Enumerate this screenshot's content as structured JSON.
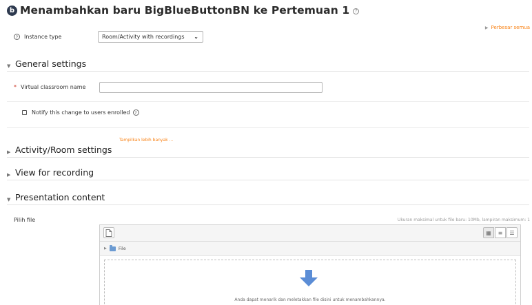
{
  "header": {
    "logo_letter": "b",
    "title": "Menambahkan baru BigBlueButtonBN ke Pertemuan 1",
    "help_glyph": "?"
  },
  "expand_all": {
    "label": "Perbesar semua"
  },
  "instance_type": {
    "label": "Instance type",
    "help_glyph": "?",
    "selected": "Room/Activity with recordings"
  },
  "sections": {
    "general": {
      "title": "General settings",
      "expanded": true
    },
    "activity_room": {
      "title": "Activity/Room settings",
      "expanded": false
    },
    "view_recording": {
      "title": "View for recording",
      "expanded": false
    },
    "presentation": {
      "title": "Presentation content",
      "expanded": true
    }
  },
  "virtual_classroom": {
    "required_mark": "*",
    "label": "Virtual classroom name",
    "value": ""
  },
  "notify": {
    "label": "Notify this change to users enrolled",
    "help_glyph": "?",
    "checked": false
  },
  "show_more": {
    "label": "Tampilkan lebih banyak ..."
  },
  "file_picker": {
    "label": "Pilih file",
    "max_size": "Ukuran maksimal untuk file baru: 10Mb, lampiran maksimum: 1",
    "folder_label": "File",
    "drop_text": "Anda dapat menarik dan meletakkan file disini untuk menambahkannya."
  },
  "icons": {
    "logo": "bigbluebutton-logo-icon",
    "help": "question-circle-icon",
    "chevron": "chevron-down-icon",
    "expanded": "triangle-down-icon",
    "collapsed": "triangle-right-icon",
    "add_file": "file-add-icon",
    "view_icons": "grid-view-icon",
    "view_list": "list-view-icon",
    "view_tree": "tree-view-icon",
    "folder": "folder-icon",
    "drop": "arrow-down-icon"
  },
  "colors": {
    "accent_link": "#f98012",
    "required": "#ca3120",
    "logo_bg": "#2e3a4f",
    "drop_arrow": "#5b8dd6"
  }
}
